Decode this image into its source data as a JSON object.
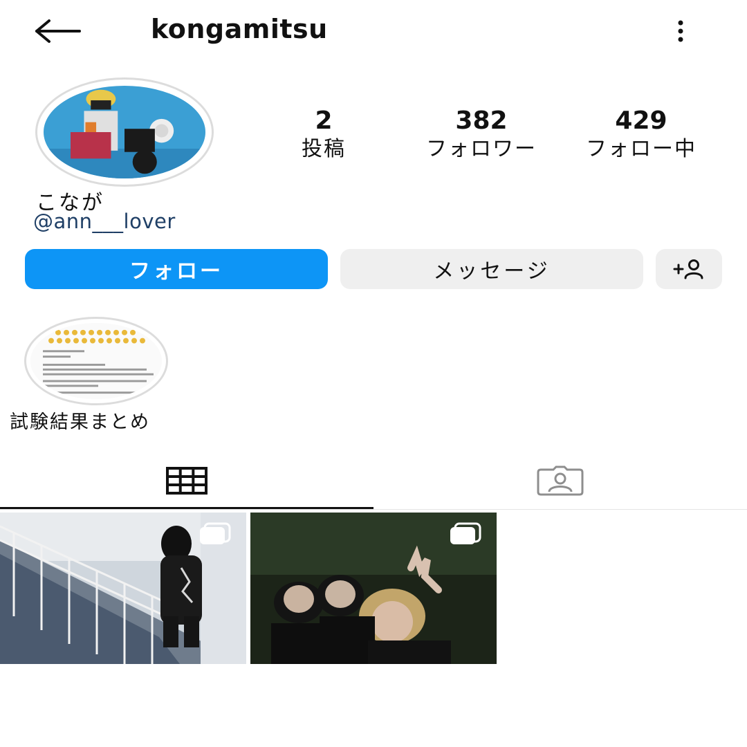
{
  "header": {
    "username": "kongamitsu",
    "back_icon": "arrow-left-icon",
    "more_icon": "more-vertical-icon"
  },
  "profile": {
    "display_name": "こなが",
    "linked_account": "@ann___lover",
    "stats": {
      "posts": {
        "value": "2",
        "label": "投稿"
      },
      "followers": {
        "value": "382",
        "label": "フォロワー"
      },
      "following": {
        "value": "429",
        "label": "フォロー中"
      }
    }
  },
  "actions": {
    "follow_label": "フォロー",
    "message_label": "メッセージ",
    "add_user_icon": "add-user-icon"
  },
  "highlights": [
    {
      "label": "試験結果まとめ"
    }
  ],
  "tabs": [
    {
      "name": "grid",
      "icon": "grid-icon",
      "active": true
    },
    {
      "name": "tagged",
      "icon": "tagged-person-icon",
      "active": false
    }
  ],
  "posts": [
    {
      "type": "carousel"
    },
    {
      "type": "carousel"
    }
  ],
  "colors": {
    "follow_button": "#0d95f6",
    "secondary_button": "#efefef",
    "link_text": "#1f3f66"
  }
}
